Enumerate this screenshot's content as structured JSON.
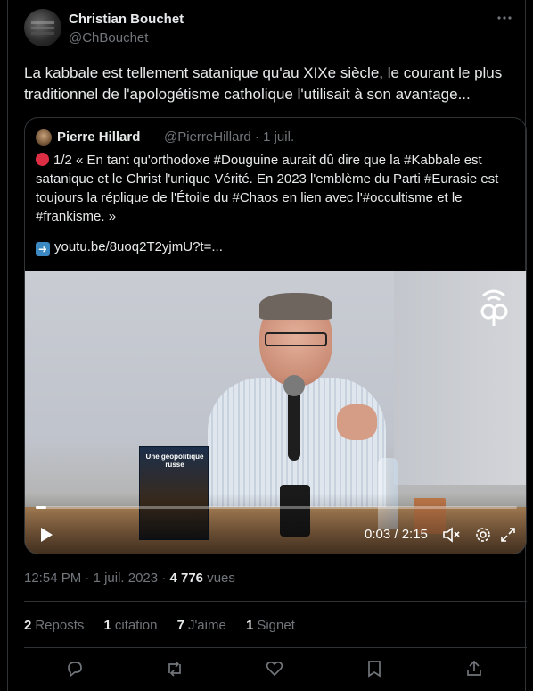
{
  "author": {
    "name": "Christian Bouchet",
    "handle": "@ChBouchet"
  },
  "tweet": {
    "text": "La kabbale est tellement satanique qu'au XIXe siècle, le courant le plus traditionnel de l'apologétisme catholique l'utilisait à son avantage..."
  },
  "quote": {
    "name": "Pierre Hillard",
    "handle": "@PierreHillard",
    "date": "1 juil.",
    "text": "1/2 « En tant qu'orthodoxe #Douguine aurait dû dire que la #Kabbale est satanique et le Christ l'unique Vérité. En 2023 l'emblème du Parti #Eurasie est toujours la réplique de l'Étoile du #Chaos en lien avec l'#occultisme et le #frankisme. »",
    "link": "youtu.be/8uoq2T2yjmU?t=..."
  },
  "video": {
    "time": "0:03 / 2:15",
    "progress": 0.022,
    "book_title": "Une géopolitique russe"
  },
  "meta": {
    "time": "12:54 PM",
    "date": "1 juil. 2023",
    "views_count": "4 776",
    "views_label": "vues"
  },
  "stats": {
    "reposts": {
      "count": "2",
      "label": "Reposts"
    },
    "quotes": {
      "count": "1",
      "label": "citation"
    },
    "likes": {
      "count": "7",
      "label": "J'aime"
    },
    "bookmarks": {
      "count": "1",
      "label": "Signet"
    }
  },
  "icons": [
    "more-icon",
    "play-icon",
    "mute-icon",
    "settings-icon",
    "fullscreen-icon",
    "reply-icon",
    "repost-icon",
    "like-icon",
    "bookmark-icon",
    "share-icon"
  ],
  "colors": {
    "background": "#000000",
    "text": "#e7e9ea",
    "muted": "#71767b",
    "border": "#2f3336"
  }
}
